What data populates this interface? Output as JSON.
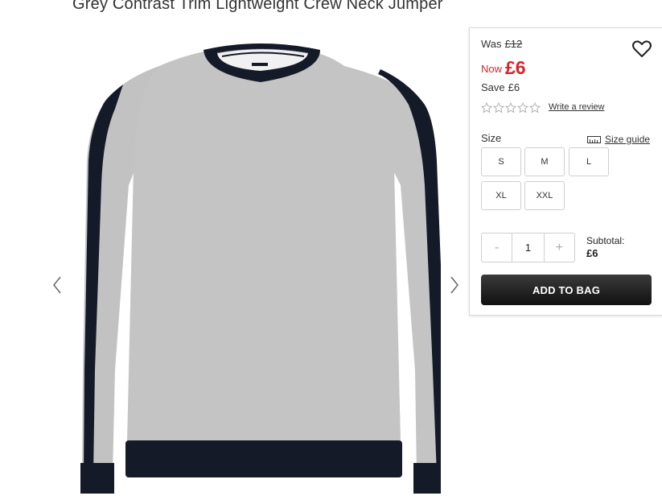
{
  "product": {
    "title": "Grey Contrast Trim Lightweight Crew Neck Jumper",
    "image_alt": "grey-crew-neck-jumper-image"
  },
  "pricing": {
    "was_label": "Was",
    "was_price": "£12",
    "now_label": "Now",
    "now_price": "£6",
    "save_label": "Save",
    "save_amount": "£6"
  },
  "rating": {
    "stars": 0,
    "max_stars": 5,
    "review_link": "Write a review"
  },
  "size": {
    "label": "Size",
    "guide_label": "Size guide",
    "options": [
      "S",
      "M",
      "L",
      "XL",
      "XXL"
    ]
  },
  "quantity": {
    "minus": "-",
    "value": "1",
    "plus": "+"
  },
  "subtotal": {
    "label": "Subtotal:",
    "value": "£6"
  },
  "cta": {
    "add_to_bag": "ADD TO BAG"
  },
  "colors": {
    "sale_red": "#d8232a",
    "jumper_grey": "#bdbdbd",
    "trim_navy": "#141a2a",
    "button_dark": "#1e1e1e"
  },
  "icons": {
    "wishlist": "heart-icon",
    "prev": "chevron-left-icon",
    "next": "chevron-right-icon",
    "star": "star-outline-icon",
    "size_guide": "ruler-icon"
  }
}
